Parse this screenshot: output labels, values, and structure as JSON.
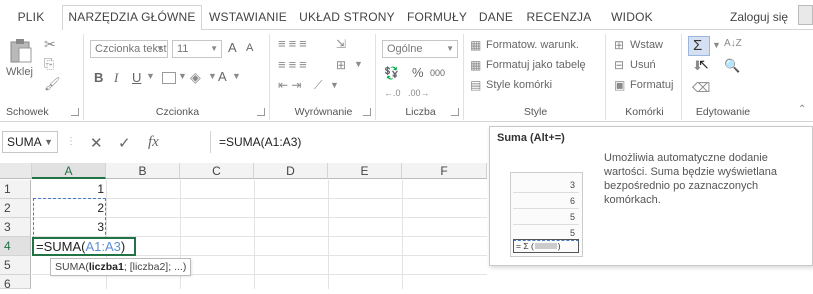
{
  "tabs": {
    "file": "PLIK",
    "home": "NARZĘDZIA GŁÓWNE",
    "insert": "WSTAWIANIE",
    "layout": "UKŁAD STRONY",
    "formulas": "FORMUŁY",
    "data": "DANE",
    "review": "RECENZJA",
    "view": "WIDOK",
    "login": "Zaloguj się"
  },
  "ribbon": {
    "clipboard": {
      "paste": "Wklej",
      "label": "Schowek"
    },
    "font": {
      "name": "Czcionka tekst",
      "size": "11",
      "bold": "B",
      "italic": "I",
      "underline": "U",
      "grow": "A",
      "shrink": "A",
      "label": "Czcionka"
    },
    "alignment": {
      "label": "Wyrównanie"
    },
    "number": {
      "format": "Ogólne",
      "percent": "%",
      "thousands": "000",
      "label": "Liczba"
    },
    "styles": {
      "conditional": "Formatow. warunk.",
      "table": "Formatuj jako tabelę",
      "cell": "Style komórki",
      "label": "Style"
    },
    "cells": {
      "insert": "Wstaw",
      "delete": "Usuń",
      "format": "Formatuj",
      "label": "Komórki"
    },
    "editing": {
      "label": "Edytowanie"
    }
  },
  "formula_bar": {
    "name_box": "SUMA",
    "cancel": "✕",
    "enter": "✓",
    "fx": "fx",
    "formula": "=SUMA(A1:A3)"
  },
  "grid": {
    "columns": [
      "A",
      "B",
      "C",
      "D",
      "E",
      "F"
    ],
    "rows": [
      "1",
      "2",
      "3",
      "4",
      "5",
      "6"
    ],
    "values": {
      "a1": "1",
      "a2": "2",
      "a3": "3"
    },
    "edit": {
      "prefix": "=SUMA(",
      "ref": "A1:A3",
      "suffix": ")"
    },
    "tip": {
      "fn": "SUMA(",
      "arg1": "liczba1",
      "rest": "; [liczba2]; ...)"
    }
  },
  "tooltip": {
    "title": "Suma (Alt+=)",
    "description": "Umożliwia automatyczne dodanie wartości. Suma będzie wyświetlana bezpośrednio po zaznaczonych komórkach.",
    "cells": [
      "3",
      "6",
      "5",
      "5"
    ],
    "sum_label": "= Σ ("
  },
  "colors": {
    "accent": "#217346",
    "ref_blue": "#5b8fd6"
  }
}
